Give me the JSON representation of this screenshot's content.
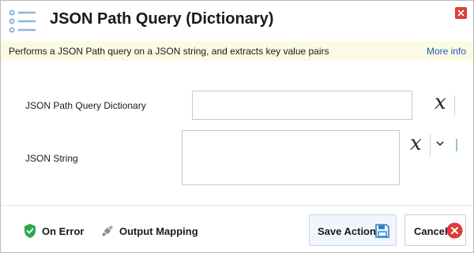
{
  "dialog": {
    "title": "JSON Path Query (Dictionary)",
    "description": "Performs a JSON Path query on a JSON string, and extracts key value pairs",
    "more_info": "More info"
  },
  "fields": [
    {
      "label": "JSON Path Query Dictionary",
      "value": "",
      "variable_button": "x"
    },
    {
      "label": "JSON String",
      "value": "",
      "variable_button": "x"
    }
  ],
  "footer": {
    "on_error": "On Error",
    "output_mapping": "Output Mapping",
    "save_action": "Save Action",
    "cancel": "Cancel"
  },
  "colors": {
    "close_red": "#e23a3a",
    "info_bar": "#fcf9e4",
    "link_blue": "#1f5fb8",
    "shield_green": "#2fa84f",
    "save_blue": "#2f7fc8"
  },
  "icons": {
    "title": "list-icon",
    "close": "close-icon",
    "on_error": "shield-check-icon",
    "output_mapping": "satellite-icon",
    "save": "floppy-disk-icon",
    "cancel": "cancel-circle-icon"
  }
}
